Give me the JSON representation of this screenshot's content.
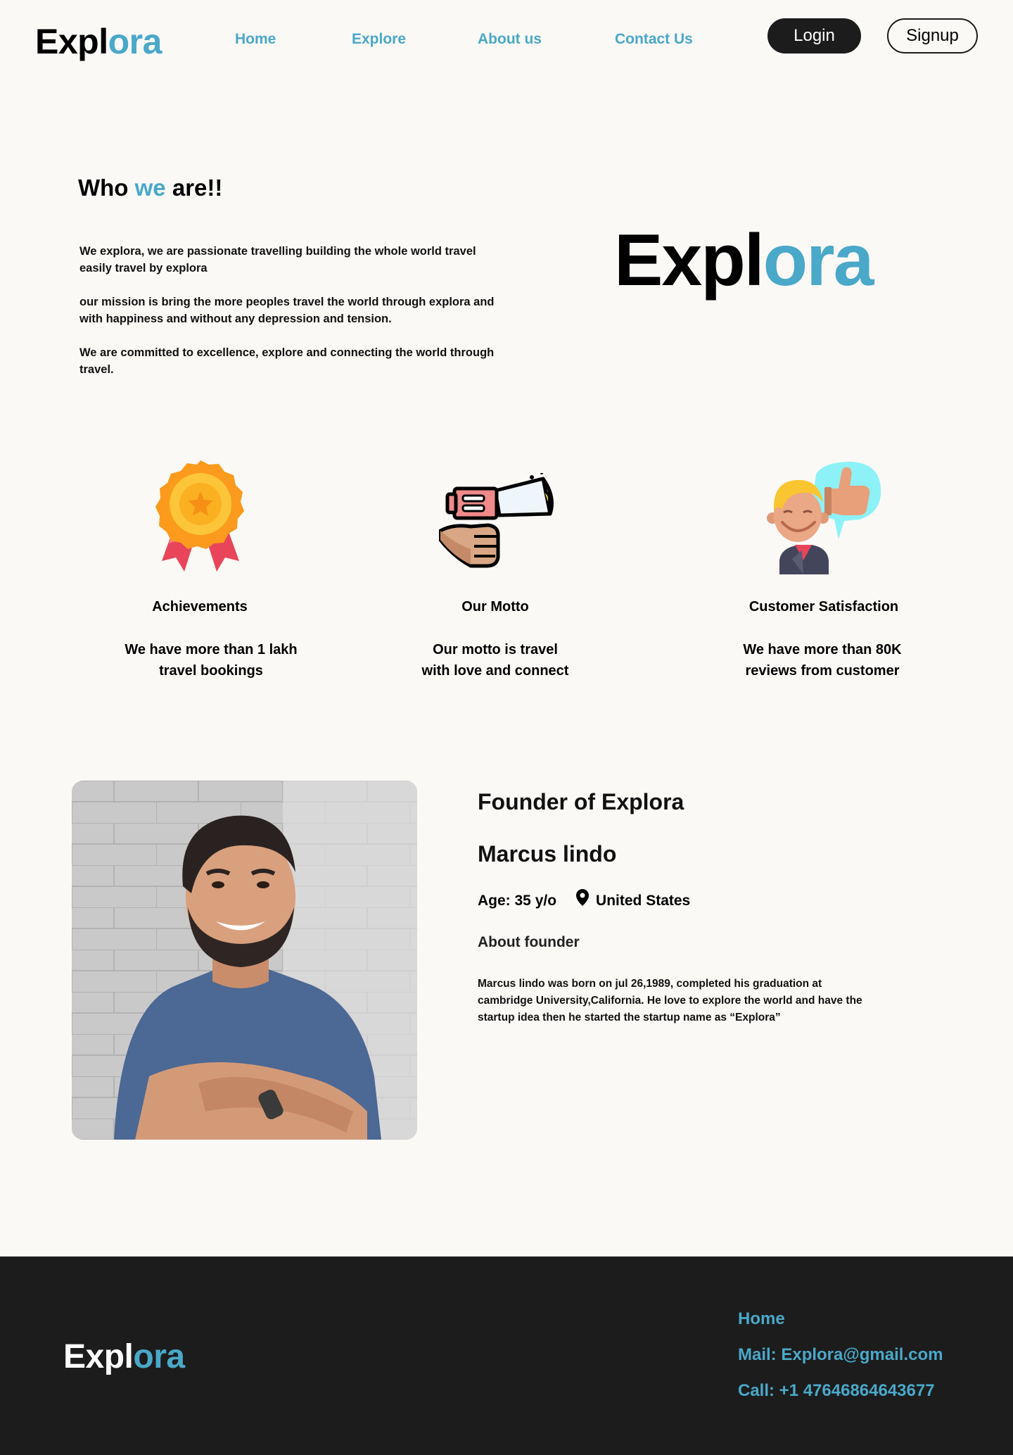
{
  "nav": {
    "logo": {
      "part1": "Expl",
      "part2": "ora"
    },
    "links": [
      "Home",
      "Explore",
      "About us",
      "Contact Us"
    ],
    "login_label": "Login",
    "signup_label": "Signup"
  },
  "about": {
    "title": {
      "part1": "Who ",
      "part2": "we",
      "part3": " are!!"
    },
    "paragraphs": [
      "We explora, we are passionate travelling building the whole world travel easily travel by explora",
      "our mission is bring the more peoples travel the world through explora and with happiness and without any depression and tension.",
      "We are committed to excellence, explore and connecting the world through travel."
    ],
    "big_logo": {
      "part1": "Expl",
      "part2": "ora"
    }
  },
  "features": [
    {
      "icon": "medal-icon",
      "title": "Achievements",
      "desc_line1": "We have more  than 1 lakh",
      "desc_line2": "travel bookings"
    },
    {
      "icon": "megaphone-icon",
      "title": "Our Motto",
      "desc_line1": "Our motto is travel",
      "desc_line2": "with love and connect"
    },
    {
      "icon": "customer-thumbs-up-icon",
      "title": "Customer Satisfaction",
      "desc_line1": "We have more than 80K",
      "desc_line2": "reviews from customer"
    }
  ],
  "founder": {
    "heading": "Founder of Explora",
    "name": "Marcus lindo",
    "age": "Age: 35 y/o",
    "location": "United States",
    "about_label": "About founder",
    "bio": "Marcus lindo was born on jul 26,1989, completed his graduation at cambridge University,California. He love to explore the world and have the startup idea then he started the startup name as “Explora”"
  },
  "footer": {
    "logo": {
      "part1": "Expl",
      "part2": "ora"
    },
    "home": "Home",
    "mail": "Mail: Explora@gmail.com",
    "call": "Call: +1 47646864643677"
  },
  "colors": {
    "accent": "#4aa8c9",
    "dark": "#1c1c1c",
    "background": "#faf9f6"
  }
}
